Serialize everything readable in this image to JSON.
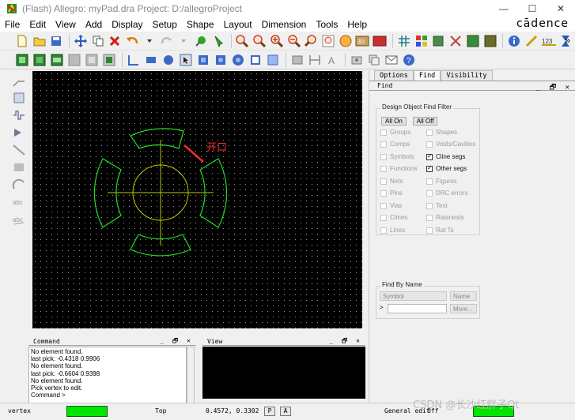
{
  "window": {
    "title": "(Flash) Allegro: myPad.dra  Project: D:/allegroProject",
    "minimize": "—",
    "maximize": "☐",
    "close": "✕"
  },
  "menu": {
    "items": [
      "File",
      "Edit",
      "View",
      "Add",
      "Display",
      "Setup",
      "Shape",
      "Layout",
      "Dimension",
      "Tools",
      "Help"
    ],
    "brand": "cādence",
    "overflow": "»"
  },
  "canvas": {
    "annotation": "开口",
    "colors": {
      "background": "#000000",
      "pad_outline": "#22dd22",
      "crosshair": "#c8c800",
      "annotation": "#ff2a2a"
    }
  },
  "right_panel": {
    "tabs": [
      "Options",
      "Find",
      "Visibility"
    ],
    "active_tab": "Find",
    "find_header": "Find",
    "find_filter": {
      "legend": "Design Object Find Filter",
      "all_on": "All On",
      "all_off": "All Off",
      "items": [
        {
          "label": "Groups",
          "checked": false
        },
        {
          "label": "Shapes",
          "checked": false
        },
        {
          "label": "Comps",
          "checked": false
        },
        {
          "label": "Voids/Cavities",
          "checked": false
        },
        {
          "label": "Symbols",
          "checked": false
        },
        {
          "label": "Cline segs",
          "checked": true
        },
        {
          "label": "Functions",
          "checked": false
        },
        {
          "label": "Other segs",
          "checked": true
        },
        {
          "label": "Nets",
          "checked": false
        },
        {
          "label": "Figures",
          "checked": false
        },
        {
          "label": "Pins",
          "checked": false
        },
        {
          "label": "DRC errors",
          "checked": false
        },
        {
          "label": "Vias",
          "checked": false
        },
        {
          "label": "Text",
          "checked": false
        },
        {
          "label": "Clines",
          "checked": false
        },
        {
          "label": "Ratsnests",
          "checked": false
        },
        {
          "label": "Lines",
          "checked": false
        },
        {
          "label": "Rat Ts",
          "checked": false
        }
      ]
    },
    "find_by_name": {
      "legend": "Find By Name",
      "type_value": "Symbol",
      "mode_value": "Name",
      "arrow": ">",
      "more_button": "More..."
    }
  },
  "command": {
    "title": "Command",
    "lines": [
      "No element found.",
      "last pick:  -0.4318 0.9906",
      "No element found.",
      "last pick:  -0.6604 0.9398",
      "No element found.",
      "Pick vertex to edit.",
      "Command >"
    ]
  },
  "view": {
    "title": "View"
  },
  "window_controls": {
    "min": "_",
    "float": "🗗",
    "close": "✕"
  },
  "status": {
    "mode": "vertex",
    "layer": "Top",
    "coords": "0.4572, 0.3302",
    "p_button": "P",
    "a_button": "A",
    "edit_mode": "General edit",
    "off_label": "Off"
  },
  "watermark": "CSDN @长沙红胖子Qt"
}
